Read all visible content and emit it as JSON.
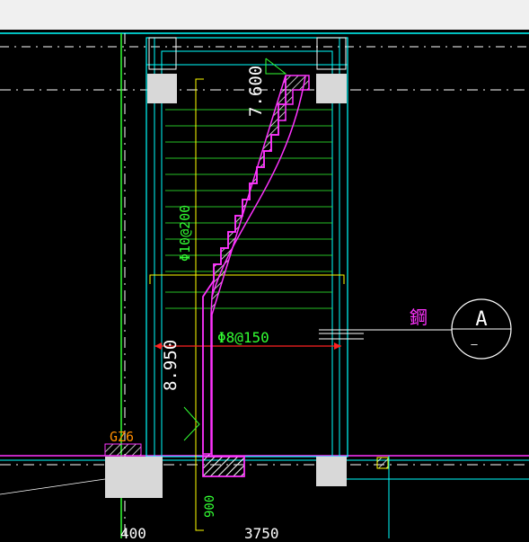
{
  "window": {
    "title_bar": ""
  },
  "drawing": {
    "elevation_top": "7.600",
    "elevation_mid": "8.950",
    "rebar_main": "Φ10@200",
    "rebar_dist": "Φ8@150",
    "note_label": "鋼",
    "section_mark": "A",
    "section_sub": "—",
    "column_tag": "GZ6",
    "dim_bottom_left": "900",
    "dim_bottom_mid": "3750",
    "dim_bottom_left2": "400"
  },
  "colors": {
    "background": "#000000",
    "topbar": "#f0f0f0",
    "cyan": "#00ffff",
    "magenta": "#ff33ff",
    "green": "#33ff33",
    "yellow": "#ffff00",
    "white": "#ffffff",
    "red": "#ff2222",
    "gray_fill": "#d8d8d8"
  }
}
